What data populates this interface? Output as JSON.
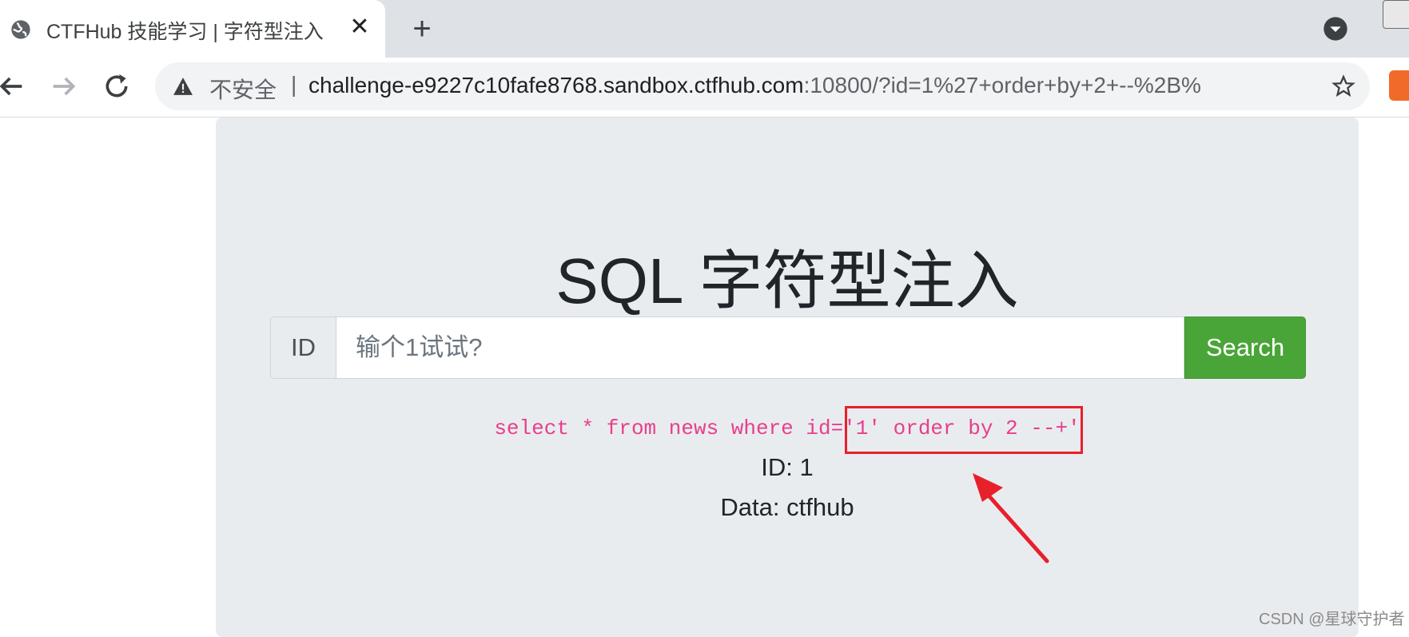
{
  "browser": {
    "tab": {
      "title": "CTFHub 技能学习 | 字符型注入",
      "close_glyph": "✕",
      "favicon": "globe-icon"
    },
    "new_tab_glyph": "+",
    "address_bar": {
      "security_label": "不安全",
      "separator": "|",
      "host": "challenge-e9227c10fafe8768.sandbox.ctfhub.com",
      "rest": ":10800/?id=1%27+order+by+2+--%2B%"
    }
  },
  "page": {
    "title": "SQL 字符型注入",
    "search": {
      "prefix_label": "ID",
      "placeholder": "输个1试试?",
      "button_label": "Search",
      "button_color": "#4aa538"
    },
    "query_text": "select * from news where id='1' order by 2 --+'",
    "result": {
      "id_line": "ID: 1",
      "data_line": "Data: ctfhub"
    }
  },
  "annotation": {
    "highlight_color": "#e8202a"
  },
  "watermark": "CSDN @星球守护者"
}
